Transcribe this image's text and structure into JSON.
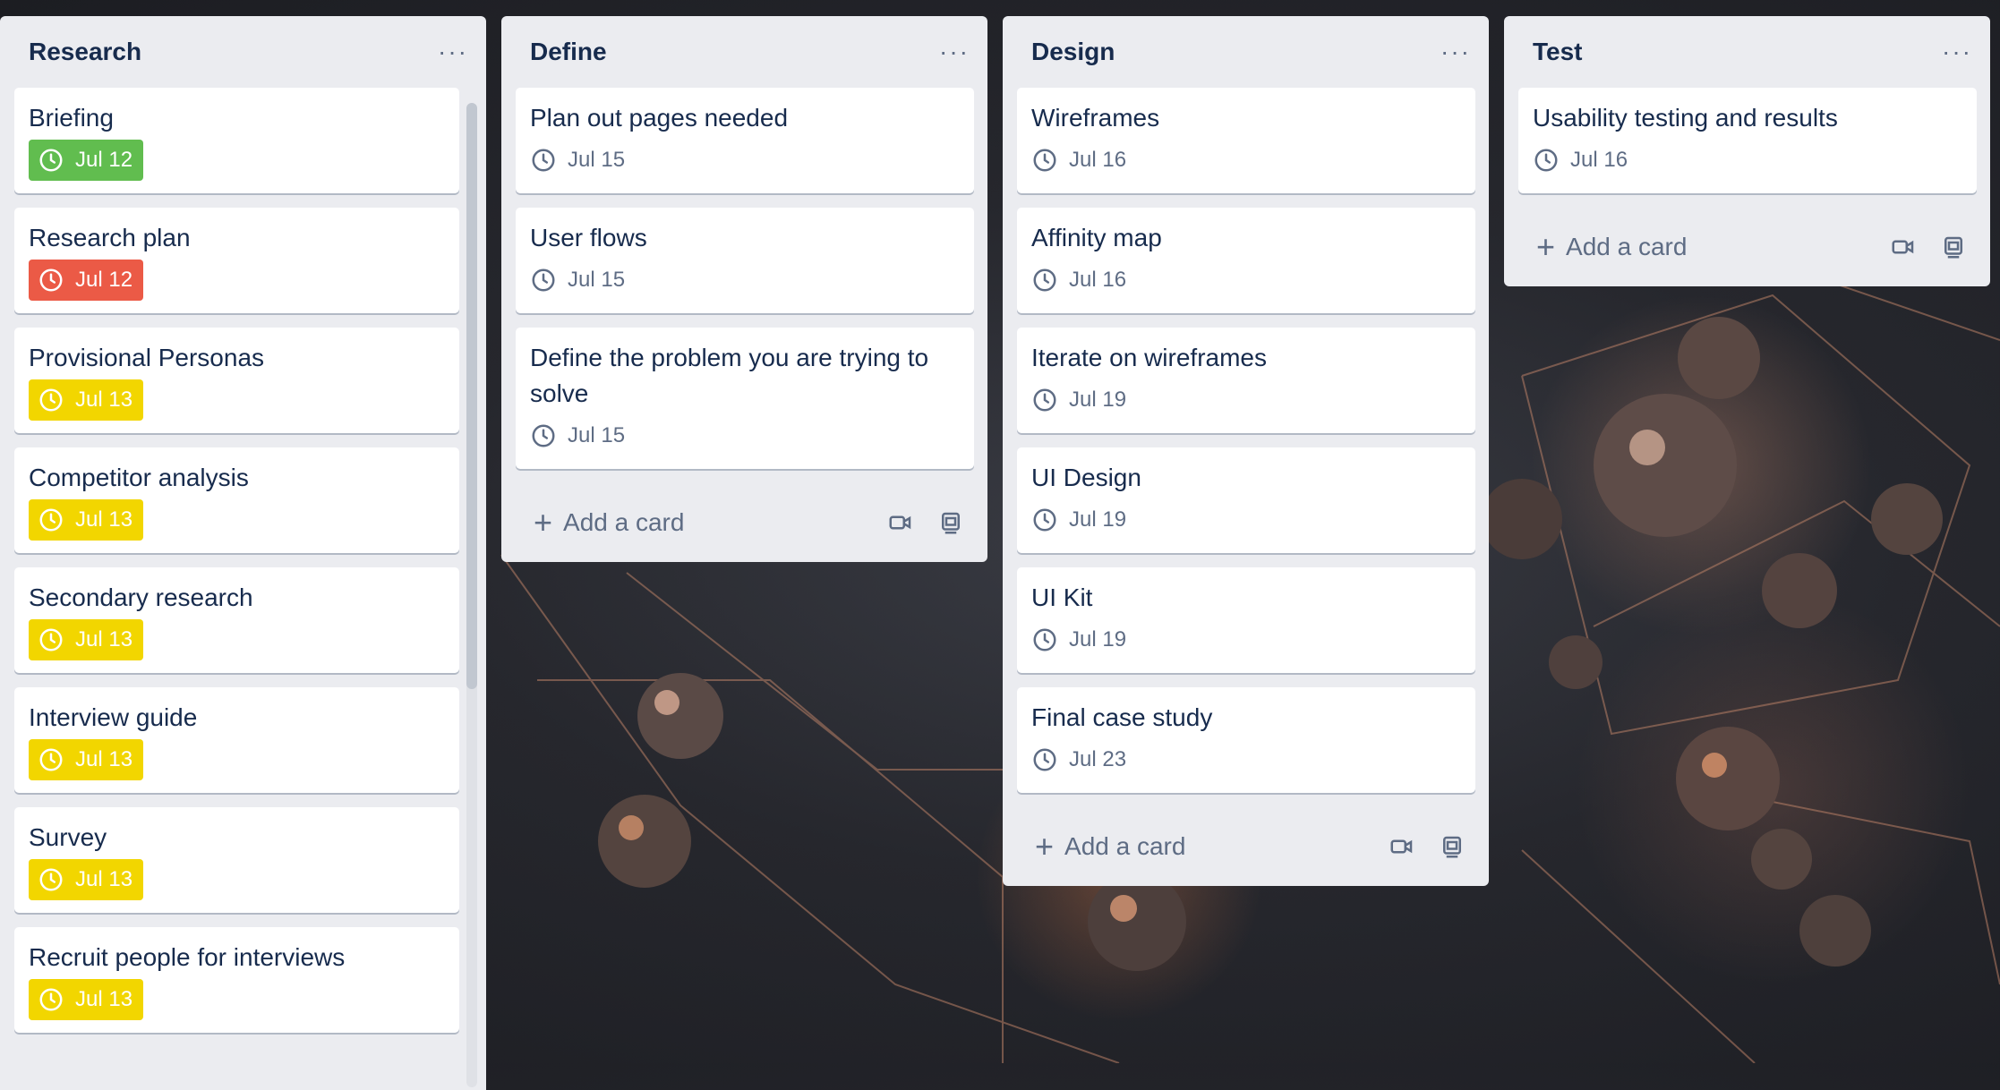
{
  "colors": {
    "green": "#61bd4f",
    "red": "#eb5a46",
    "yellow": "#f2d600"
  },
  "lists": [
    {
      "title": "Research",
      "more": "···",
      "cards": [
        {
          "title": "Briefing",
          "date": "Jul 12",
          "color": "green"
        },
        {
          "title": "Research plan",
          "date": "Jul 12",
          "color": "red"
        },
        {
          "title": "Provisional Personas",
          "date": "Jul 13",
          "color": "yellow"
        },
        {
          "title": "Competitor analysis",
          "date": "Jul 13",
          "color": "yellow"
        },
        {
          "title": "Secondary research",
          "date": "Jul 13",
          "color": "yellow"
        },
        {
          "title": "Interview guide",
          "date": "Jul 13",
          "color": "yellow"
        },
        {
          "title": "Survey",
          "date": "Jul 13",
          "color": "yellow"
        },
        {
          "title": "Recruit people for interviews",
          "date": "Jul 13",
          "color": "yellow"
        }
      ]
    },
    {
      "title": "Define",
      "more": "···",
      "cards": [
        {
          "title": "Plan out pages needed",
          "date": "Jul 15"
        },
        {
          "title": "User flows",
          "date": "Jul 15"
        },
        {
          "title": "Define the problem you are trying to solve",
          "date": "Jul 15"
        }
      ],
      "add_label": "Add a card"
    },
    {
      "title": "Design",
      "more": "···",
      "cards": [
        {
          "title": "Wireframes",
          "date": "Jul 16"
        },
        {
          "title": "Affinity map",
          "date": "Jul 16"
        },
        {
          "title": "Iterate on wireframes",
          "date": "Jul 19"
        },
        {
          "title": "UI Design",
          "date": "Jul 19"
        },
        {
          "title": "UI Kit",
          "date": "Jul 19"
        },
        {
          "title": "Final case study",
          "date": "Jul 23"
        }
      ],
      "add_label": "Add a card"
    },
    {
      "title": "Test",
      "more": "···",
      "cards": [
        {
          "title": "Usability testing and results",
          "date": "Jul 16"
        }
      ],
      "add_label": "Add a card"
    }
  ]
}
